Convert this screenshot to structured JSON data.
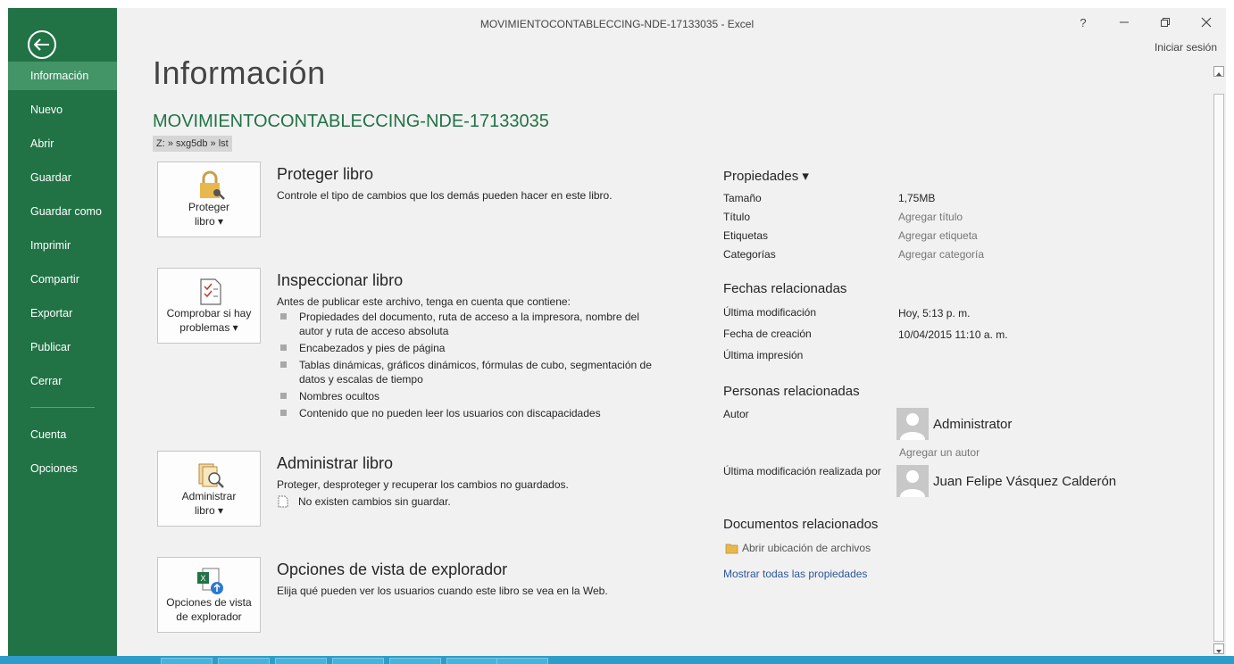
{
  "window": {
    "title": "MOVIMIENTOCONTABLECCING-NDE-17133035 - Excel",
    "help": "?",
    "sign_in": "Iniciar sesión"
  },
  "colors": {
    "accent": "#217346",
    "active_nav": "#439467",
    "link": "#2b579a"
  },
  "sidebar": {
    "items": [
      {
        "label": "Información"
      },
      {
        "label": "Nuevo"
      },
      {
        "label": "Abrir"
      },
      {
        "label": "Guardar"
      },
      {
        "label": "Guardar como"
      },
      {
        "label": "Imprimir"
      },
      {
        "label": "Compartir"
      },
      {
        "label": "Exportar"
      },
      {
        "label": "Publicar"
      },
      {
        "label": "Cerrar"
      },
      {
        "label": "Cuenta"
      },
      {
        "label": "Opciones"
      }
    ],
    "active": "Información"
  },
  "main": {
    "heading": "Información",
    "doc_name": "MOVIMIENTOCONTABLECCING-NDE-17133035",
    "path": "Z: » sxg5db » lst",
    "sections": [
      {
        "button_line1": "Proteger",
        "button_line2": "libro ▾",
        "title": "Proteger libro",
        "desc": "Controle el tipo de cambios que los demás pueden hacer en este libro."
      },
      {
        "button_line1": "Comprobar si hay",
        "button_line2": "problemas ▾",
        "title": "Inspeccionar libro",
        "desc": "Antes de publicar este archivo, tenga en cuenta que contiene:",
        "bullets": [
          "Propiedades del documento, ruta de acceso a la impresora, nombre del autor y ruta de acceso absoluta",
          "Encabezados y pies de página",
          "Tablas dinámicas, gráficos dinámicos, fórmulas de cubo, segmentación de datos y escalas de tiempo",
          "Nombres ocultos",
          "Contenido que no pueden leer los usuarios con discapacidades"
        ]
      },
      {
        "button_line1": "Administrar",
        "button_line2": "libro ▾",
        "title": "Administrar libro",
        "desc": "Proteger, desproteger y recuperar los cambios no guardados.",
        "note": "No existen cambios sin guardar."
      },
      {
        "button_line1": "Opciones de vista",
        "button_line2": "de explorador",
        "title": "Opciones de vista de explorador",
        "desc": "Elija qué pueden ver los usuarios cuando este libro se vea en la Web."
      }
    ]
  },
  "properties": {
    "heading": "Propiedades ▾",
    "rows": [
      {
        "label": "Tamaño",
        "value": "1,75MB"
      },
      {
        "label": "Título",
        "value": "Agregar título"
      },
      {
        "label": "Etiquetas",
        "value": "Agregar etiqueta"
      },
      {
        "label": "Categorías",
        "value": "Agregar categoría"
      }
    ],
    "dates_heading": "Fechas relacionadas",
    "dates": [
      {
        "label": "Última modificación",
        "value": "Hoy, 5:13 p. m."
      },
      {
        "label": "Fecha de creación",
        "value": "10/04/2015 11:10 a. m."
      },
      {
        "label": "Última impresión",
        "value": ""
      }
    ],
    "people_heading": "Personas relacionadas",
    "author_label": "Autor",
    "author_name": "Administrator",
    "add_author": "Agregar un autor",
    "last_modified_by_label": "Última modificación realizada por",
    "last_modified_by": "Juan Felipe Vásquez Calderón",
    "docs_heading": "Documentos relacionados",
    "open_location": "Abrir ubicación de archivos",
    "show_all": "Mostrar todas las propiedades"
  }
}
